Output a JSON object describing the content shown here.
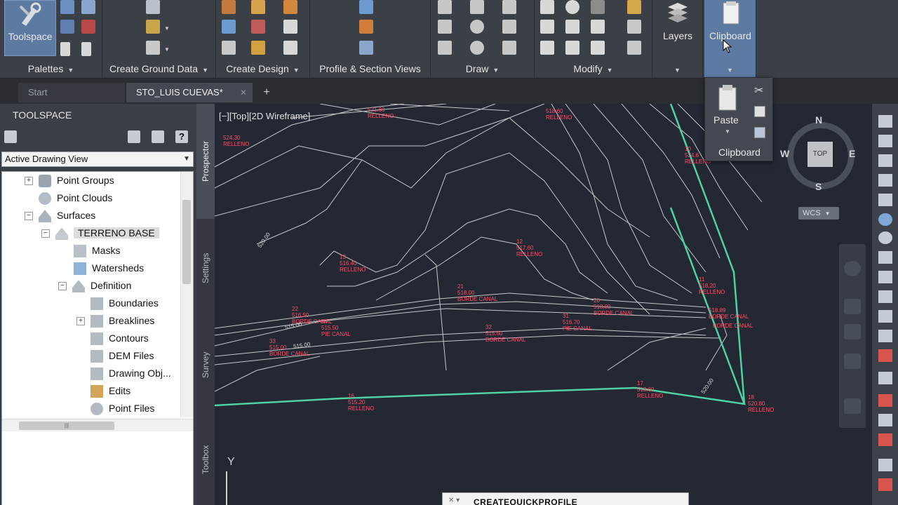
{
  "ribbon": {
    "toolspace_label": "Toolspace",
    "layers_label": "Layers",
    "clipboard_label": "Clipboard",
    "panels": [
      {
        "label": "Palettes"
      },
      {
        "label": "Create Ground Data"
      },
      {
        "label": "Create Design"
      },
      {
        "label": "Profile & Section Views"
      },
      {
        "label": "Draw"
      },
      {
        "label": "Modify"
      }
    ]
  },
  "tabs": {
    "start": "Start",
    "drawing": "STO_LUIS CUEVAS*"
  },
  "toolspace": {
    "title": "TOOLSPACE",
    "view_select": "Active Drawing View",
    "tree": [
      {
        "label": "Point Groups"
      },
      {
        "label": "Point Clouds"
      },
      {
        "label": "Surfaces"
      },
      {
        "label": "TERRENO BASE"
      },
      {
        "label": "Masks"
      },
      {
        "label": "Watersheds"
      },
      {
        "label": "Definition"
      },
      {
        "label": "Boundaries"
      },
      {
        "label": "Breaklines"
      },
      {
        "label": "Contours"
      },
      {
        "label": "DEM Files"
      },
      {
        "label": "Drawing Obj..."
      },
      {
        "label": "Edits"
      },
      {
        "label": "Point Files"
      }
    ],
    "side_tabs": [
      "Prospector",
      "Settings",
      "Survey",
      "Toolbox"
    ]
  },
  "viewport": {
    "label": "[−][Top][2D Wireframe]",
    "wcs": "WCS",
    "compass": {
      "n": "N",
      "s": "S",
      "e": "E",
      "w": "W",
      "top": "TOP"
    },
    "ucs_y": "Y",
    "contours": [
      "520.00",
      "520.00",
      "515.00",
      "515.00"
    ],
    "points": [
      {
        "n": "",
        "z": "521.60",
        "d": "RELLENO"
      },
      {
        "n": "",
        "z": "524.30",
        "d": "RELLENO"
      },
      {
        "n": "",
        "z": "518.60",
        "d": "RELLENO"
      },
      {
        "n": "10",
        "z": "524.6",
        "d": "RELLENO"
      },
      {
        "n": "12",
        "z": "517.60",
        "d": "RELLENO"
      },
      {
        "n": "13",
        "z": "516.40",
        "d": "RELLENO"
      },
      {
        "n": "11",
        "z": "518.20",
        "d": "RELLENO"
      },
      {
        "n": "21",
        "z": "518.00",
        "d": "BORDE CANAL"
      },
      {
        "n": "20",
        "z": "518.00",
        "d": "BORDE CANAL"
      },
      {
        "n": "22",
        "z": "516.50",
        "d": "BORDE CANAL"
      },
      {
        "n": "24",
        "z": "515.50",
        "d": "PIE CANAL"
      },
      {
        "n": "31",
        "z": "516.70",
        "d": "PIE CANAL"
      },
      {
        "n": "32",
        "z": "515.50",
        "d": "BORDE CANAL"
      },
      {
        "n": "33",
        "z": "515.00",
        "d": "BORDE CANAL"
      },
      {
        "n": "",
        "z": "518.89",
        "d": "BORDE CANAL"
      },
      {
        "n": "",
        "z": "",
        "d": "BORDE CANAL"
      },
      {
        "n": "17",
        "z": "518.60",
        "d": "RELLENO"
      },
      {
        "n": "16",
        "z": "515.20",
        "d": "RELLENO"
      },
      {
        "n": "18",
        "z": "520.80",
        "d": "RELLENO"
      }
    ]
  },
  "clipboard_popup": {
    "paste": "Paste",
    "footer": "Clipboard"
  },
  "command_line": {
    "text": "CREATEQUICKPROFILE"
  },
  "colors": {
    "accent": "#5d7aa3",
    "boundary": "#4fd1a5",
    "label": "#ff4d6a",
    "contour": "#d8d8d8"
  }
}
